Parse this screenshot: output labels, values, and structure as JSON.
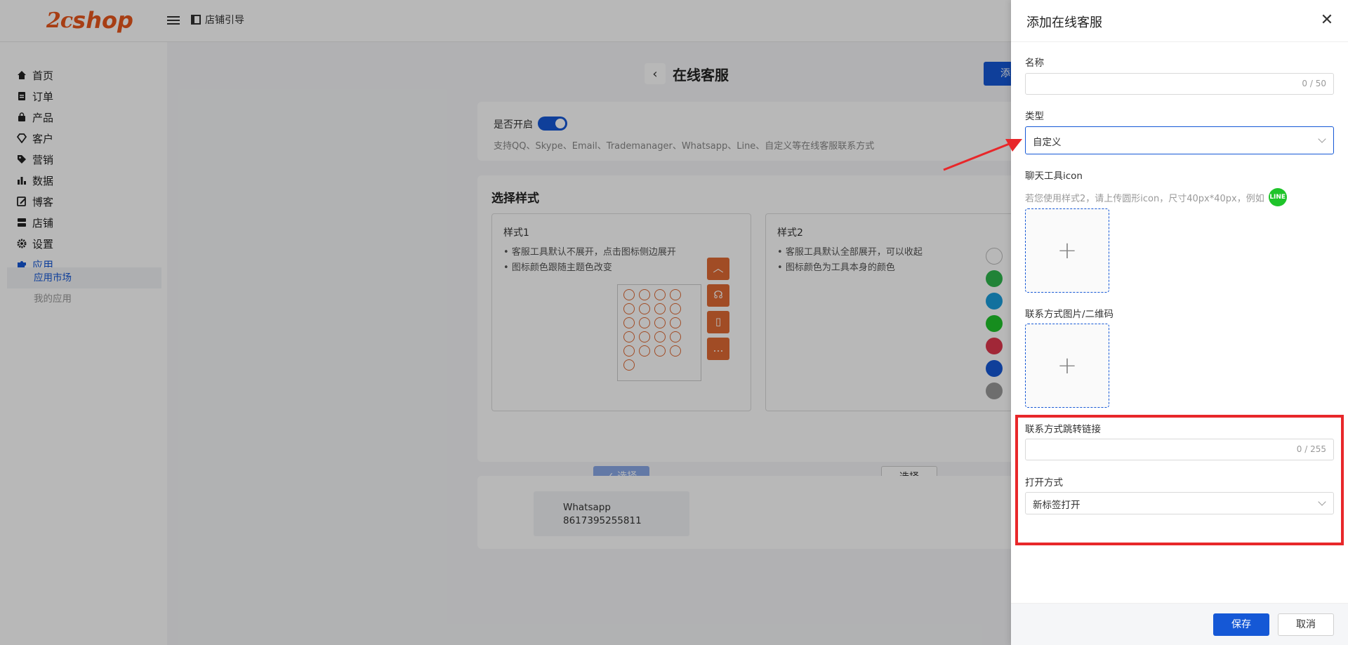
{
  "header": {
    "logo_mark": "2c",
    "logo_word": "shop",
    "guide_label": "店铺引导"
  },
  "sidebar": {
    "items": [
      {
        "label": "首页",
        "icon": "home-icon"
      },
      {
        "label": "订单",
        "icon": "clipboard-icon"
      },
      {
        "label": "产品",
        "icon": "bag-icon"
      },
      {
        "label": "客户",
        "icon": "diamond-icon"
      },
      {
        "label": "营销",
        "icon": "tag-icon"
      },
      {
        "label": "数据",
        "icon": "bar-chart-icon"
      },
      {
        "label": "博客",
        "icon": "edit-icon"
      },
      {
        "label": "店铺",
        "icon": "store-icon"
      },
      {
        "label": "设置",
        "icon": "gear-icon"
      },
      {
        "label": "应用",
        "icon": "puzzle-icon"
      }
    ],
    "sub_items": [
      {
        "label": "应用市场"
      },
      {
        "label": "我的应用"
      }
    ]
  },
  "main": {
    "title": "在线客服",
    "add_button": "添",
    "toggle_label": "是否开启",
    "toggle_on": true,
    "hint": "支持QQ、Skype、Email、Trademanager、Whatsapp、Line、自定义等在线客服联系方式",
    "section_title": "选择样式",
    "style1": {
      "title": "样式1",
      "bullets": [
        "客服工具默认不展开，点击图标侧边展开",
        "图标颜色跟随主题色改变"
      ],
      "button": "✓ 选择"
    },
    "style2": {
      "title": "样式2",
      "bullets": [
        "客服工具默认全部展开，可以收起",
        "图标颜色为工具本身的颜色"
      ],
      "button": "选择"
    },
    "contact": {
      "name": "Whatsapp",
      "number": "8617395255811"
    }
  },
  "drawer": {
    "title": "添加在线客服",
    "name_label": "名称",
    "name_count": "0 / 50",
    "type_label": "类型",
    "type_value": "自定义",
    "icon_label": "聊天工具icon",
    "icon_hint": "若您使用样式2，请上传圆形icon，尺寸40px*40px，例如",
    "qr_label": "联系方式图片/二维码",
    "link_label": "联系方式跳转链接",
    "link_count": "0 / 255",
    "open_label": "打开方式",
    "open_value": "新标签打开",
    "save": "保存",
    "cancel": "取消"
  },
  "colors": {
    "primary": "#1558d6",
    "brand": "#e8561c",
    "highlight": "#e8272a"
  }
}
